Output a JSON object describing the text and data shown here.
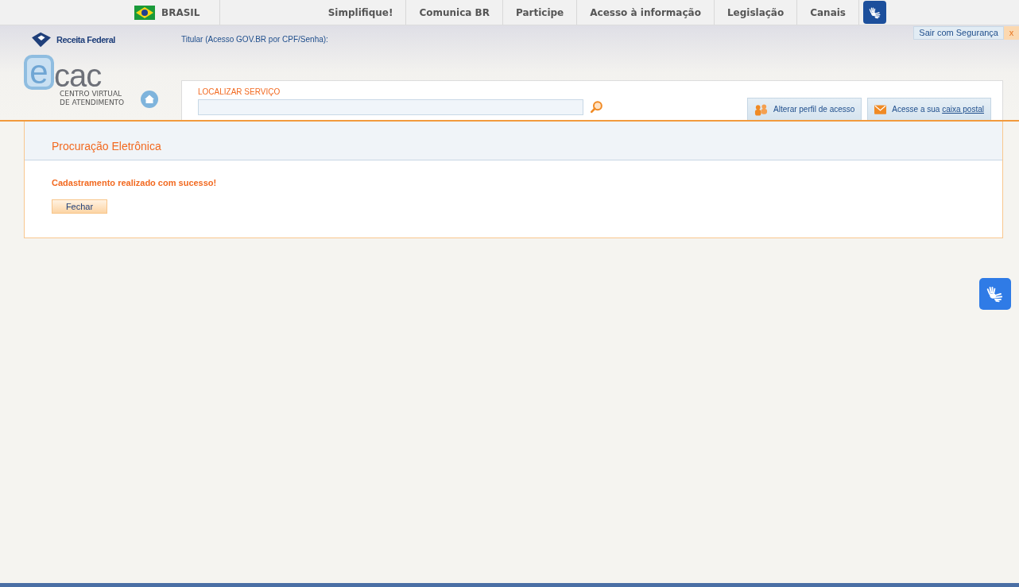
{
  "gov_bar": {
    "country": "BRASIL",
    "links": [
      "Simplifique!",
      "Comunica BR",
      "Participe",
      "Acesso à informação",
      "Legislação",
      "Canais"
    ]
  },
  "header": {
    "agency": "Receita Federal",
    "user_label": "Titular (Acesso GOV.BR por CPF/Senha):",
    "logout": "Sair com Segurança",
    "logout_close": "x",
    "logo": {
      "letter": "e",
      "word": "cac",
      "line_1": "CENTRO VIRTUAL",
      "line_2": "DE ATENDIMENTO"
    }
  },
  "search": {
    "label": "LOCALIZAR SERVIÇO"
  },
  "actions": [
    {
      "kind": "profile",
      "text": "Alterar perfil de acesso"
    },
    {
      "kind": "mail",
      "text": "Acesse a sua",
      "link": "caixa postal"
    }
  ],
  "panel": {
    "title": "Procuração Eletrônica",
    "message": "Cadastramento realizado com sucesso!",
    "button": "Fechar"
  }
}
